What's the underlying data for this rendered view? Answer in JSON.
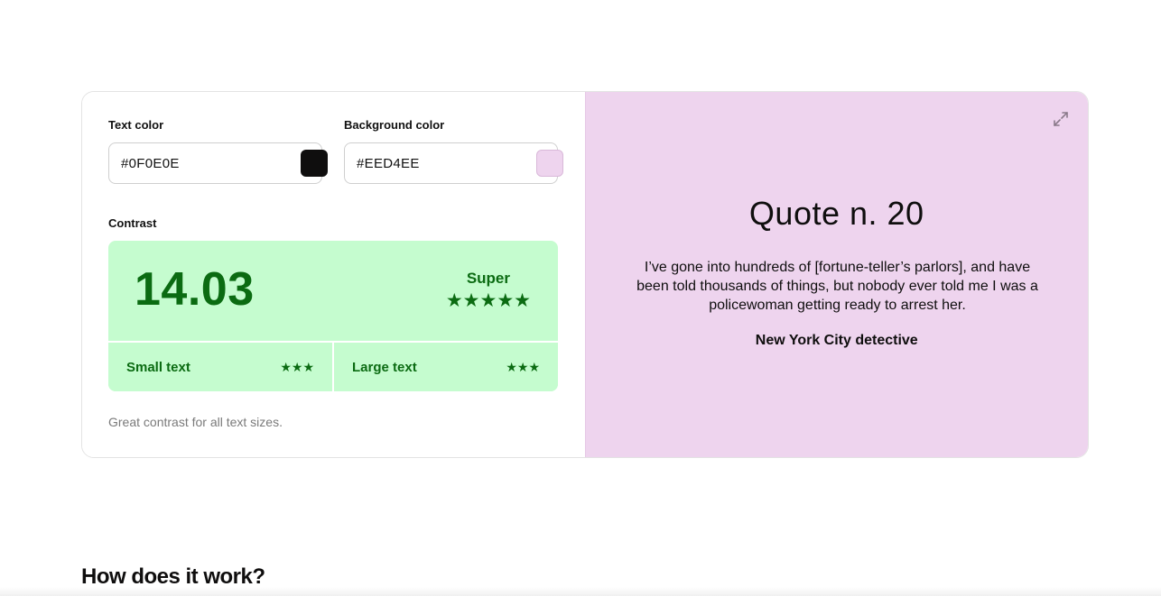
{
  "text_color": {
    "label": "Text color",
    "value": "#0F0E0E",
    "swatch": "#0f0e0e"
  },
  "background_color": {
    "label": "Background color",
    "value": "#EED4EE",
    "swatch": "#eed4ee"
  },
  "contrast": {
    "label": "Contrast",
    "score": "14.03",
    "rating": "Super",
    "rating_stars": 5,
    "stars": "★★★★★",
    "small_text": {
      "label": "Small text",
      "stars": "★★★",
      "rating": 3
    },
    "large_text": {
      "label": "Large text",
      "stars": "★★★",
      "rating": 3
    },
    "note": "Great contrast for all text sizes.",
    "color": "#0b6b12",
    "bg": "#c5fccf"
  },
  "preview": {
    "title": "Quote n. 20",
    "quote": "I’ve gone into hundreds of [fortune-teller’s parlors], and have been told thousands of things, but nobody ever told me I was a policewoman getting ready to arrest her.",
    "author": "New York City detective",
    "expand_icon": "expand-icon"
  },
  "section": {
    "heading": "How does it work?"
  }
}
